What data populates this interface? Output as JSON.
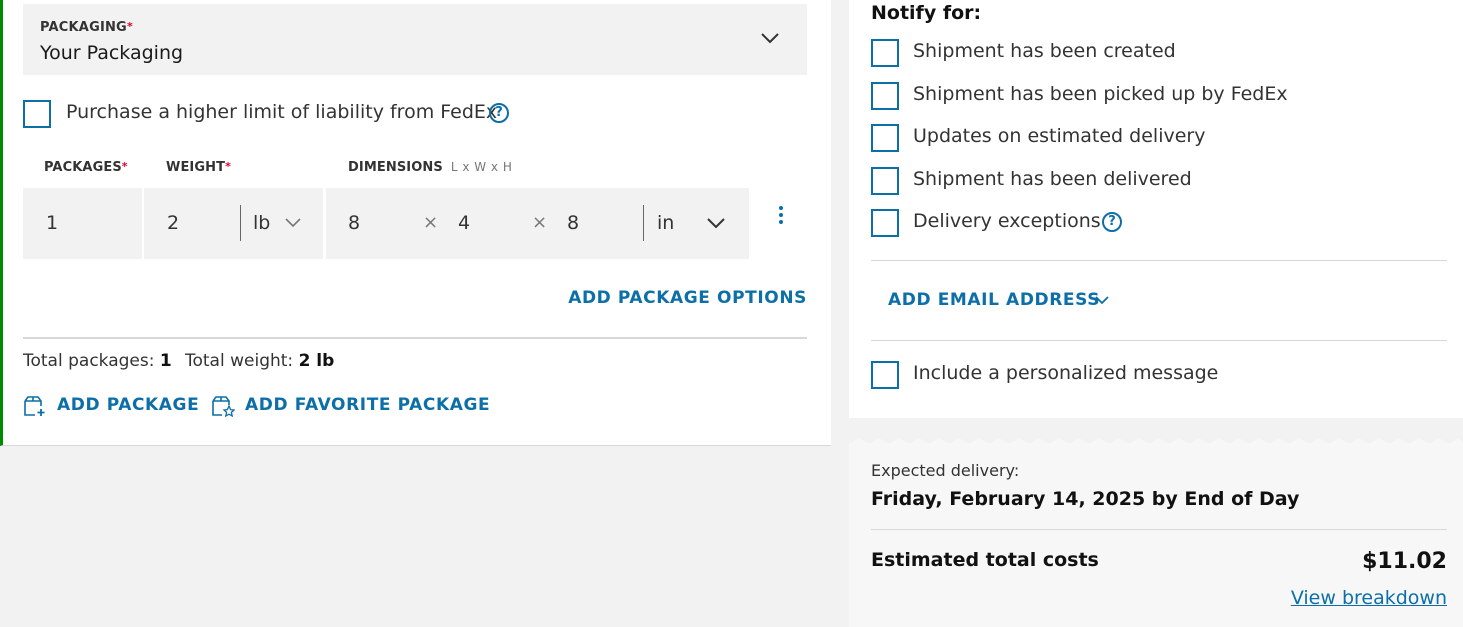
{
  "colors": {
    "accent": "#0c6fa8",
    "required": "#de002e",
    "section_border": "#008a00"
  },
  "packaging": {
    "label": "PACKAGING",
    "required_mark": "*",
    "value": "Your Packaging"
  },
  "liability": {
    "label": "Purchase a higher limit of liability from FedEx",
    "help": "?"
  },
  "package_table": {
    "packages_label": "PACKAGES",
    "weight_label": "WEIGHT",
    "dimensions_label": "DIMENSIONS",
    "dimensions_hint": "L x W x H",
    "packages_value": "1",
    "weight_value": "2",
    "weight_unit": "lb",
    "length": "8",
    "width": "4",
    "height": "8",
    "dim_unit": "in",
    "times": "×"
  },
  "add_package_options": "ADD PACKAGE OPTIONS",
  "totals": {
    "packages_label": "Total packages:",
    "packages_value": "1",
    "weight_label": "Total weight:",
    "weight_value": "2 lb"
  },
  "actions": {
    "add_package": "ADD PACKAGE",
    "add_favorite": "ADD FAVORITE PACKAGE"
  },
  "notify": {
    "title": "Notify for:",
    "options": [
      "Shipment has been created",
      "Shipment has been picked up by FedEx",
      "Updates on estimated delivery",
      "Shipment has been delivered",
      "Delivery exceptions"
    ],
    "help": "?",
    "add_email": "ADD EMAIL ADDRESS",
    "personal_message": "Include a personalized message"
  },
  "summary": {
    "expected_label": "Expected delivery:",
    "expected_date": "Friday, February 14, 2025 by End of Day",
    "cost_label": "Estimated total costs",
    "cost_value": "$11.02",
    "view_breakdown": "View breakdown"
  }
}
